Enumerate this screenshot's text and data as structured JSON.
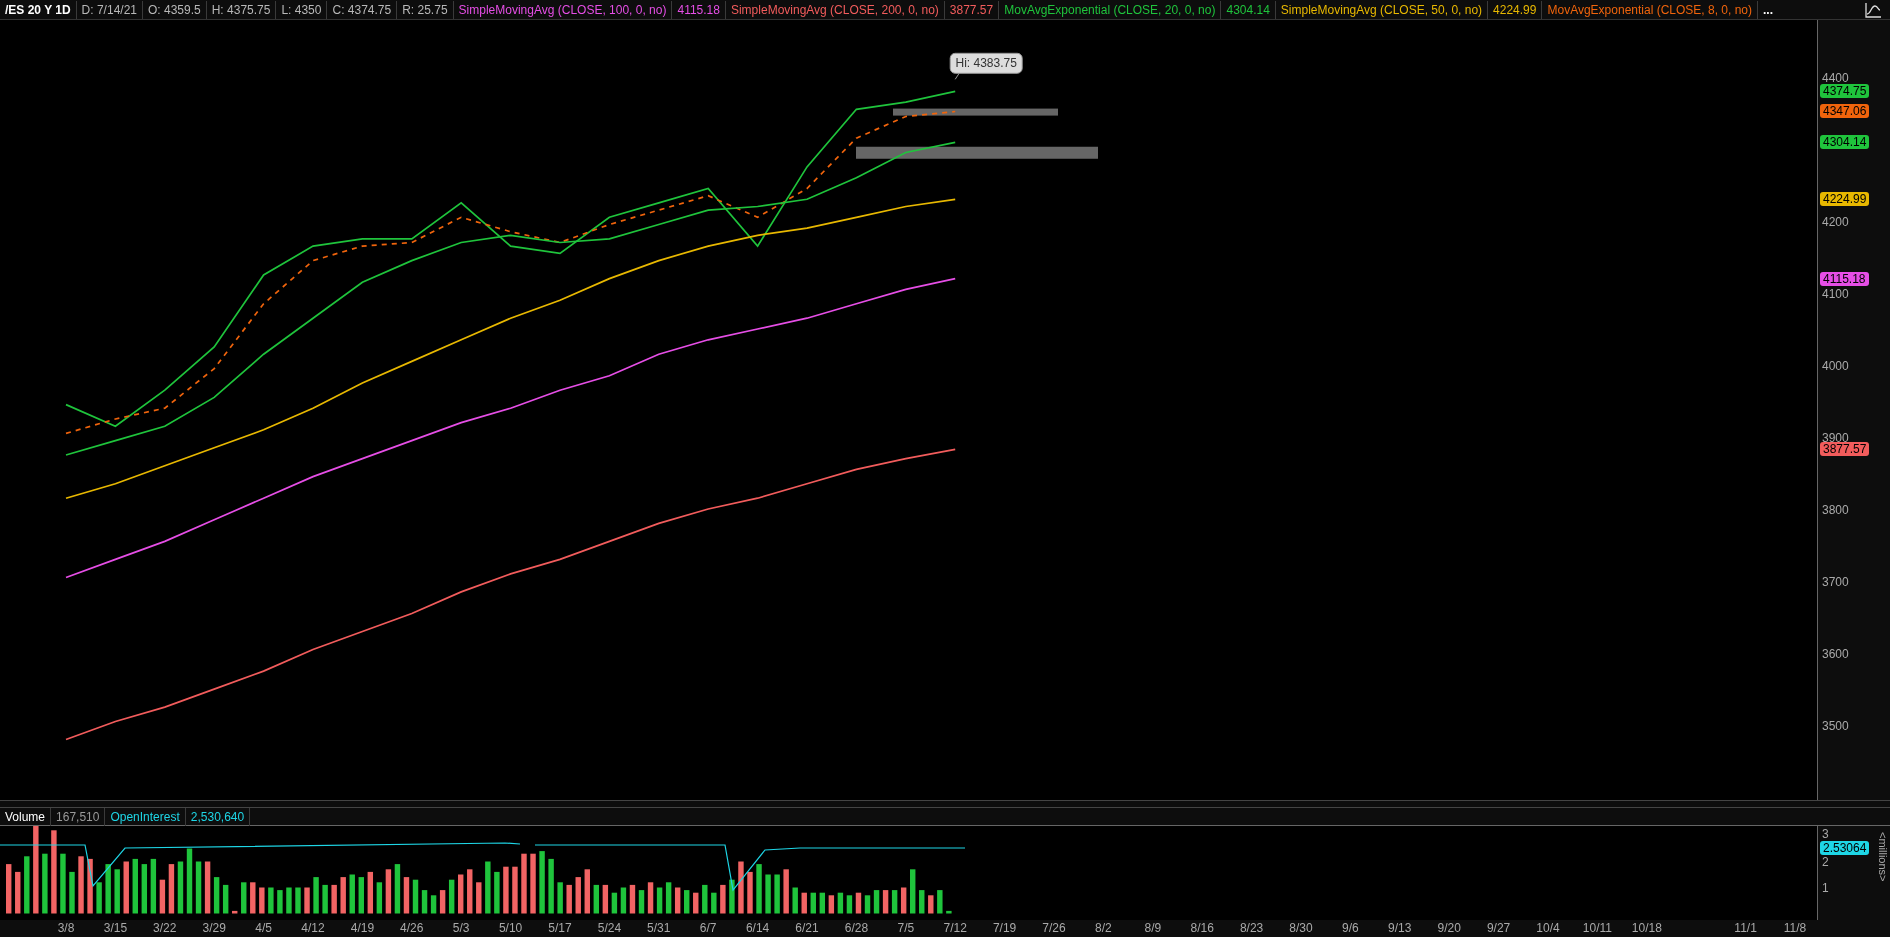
{
  "header": {
    "items": [
      {
        "kind": "symbol",
        "text": "/ES 20 Y 1D",
        "color": "#ffffff"
      },
      {
        "kind": "field",
        "text": "D: 7/14/21",
        "color": "#b8b8b8"
      },
      {
        "kind": "field",
        "text": "O: 4359.5",
        "color": "#b8b8b8"
      },
      {
        "kind": "field",
        "text": "H: 4375.75",
        "color": "#b8b8b8"
      },
      {
        "kind": "field",
        "text": "L: 4350",
        "color": "#b8b8b8"
      },
      {
        "kind": "field",
        "text": "C: 4374.75",
        "color": "#b8b8b8"
      },
      {
        "kind": "field",
        "text": "R: 25.75",
        "color": "#b8b8b8"
      },
      {
        "kind": "study",
        "text": "SimpleMovingAvg (CLOSE, 100, 0, no)",
        "color": "#e64ee6"
      },
      {
        "kind": "field",
        "text": "4115.18",
        "color": "#e64ee6"
      },
      {
        "kind": "study",
        "text": "SimpleMovingAvg (CLOSE, 200, 0, no)",
        "color": "#f25c5c"
      },
      {
        "kind": "field",
        "text": "3877.57",
        "color": "#f25c5c"
      },
      {
        "kind": "study",
        "text": "MovAvgExponential (CLOSE, 20, 0, no)",
        "color": "#1fc43c"
      },
      {
        "kind": "field",
        "text": "4304.14",
        "color": "#1fc43c"
      },
      {
        "kind": "study",
        "text": "SimpleMovingAvg (CLOSE, 50, 0, no)",
        "color": "#e8b800"
      },
      {
        "kind": "field",
        "text": "4224.99",
        "color": "#e8b800"
      },
      {
        "kind": "study",
        "text": "MovAvgExponential (CLOSE, 8, 0, no)",
        "color": "#f0640c"
      },
      {
        "kind": "more",
        "text": "...",
        "color": "#ffffff"
      }
    ]
  },
  "price_chart": {
    "badges": [
      "4374.75",
      "4347.06",
      "4304.14",
      "4224.99",
      "4115.18",
      "3877.57"
    ],
    "chart_data": {
      "type": "line",
      "categories": [
        "3/8",
        "3/15",
        "3/22",
        "3/29",
        "4/5",
        "4/12",
        "4/19",
        "4/26",
        "5/3",
        "5/10",
        "5/17",
        "5/24",
        "5/31",
        "6/7",
        "6/14",
        "6/21",
        "6/28",
        "7/5",
        "7/12",
        "7/19",
        "7/26",
        "8/2",
        "8/9",
        "8/16",
        "8/23",
        "8/30",
        "9/6",
        "9/13",
        "9/20",
        "9/27",
        "10/4",
        "10/11",
        "10/18",
        null,
        "11/1",
        "11/8"
      ],
      "ylim": [
        3391,
        4474
      ],
      "yticks": [
        3500,
        3600,
        3700,
        3800,
        3900,
        4000,
        4100,
        4200,
        4400
      ],
      "series": [
        {
          "color": "#1fc43c",
          "line_style": "solid",
          "values": [
            3940,
            3910,
            3960,
            4020,
            4120,
            4160,
            4170,
            4170,
            4220,
            4160,
            4150,
            4200,
            4220,
            4240,
            4160,
            4270,
            4350,
            4360,
            4375,
            null,
            null,
            null,
            null,
            null,
            null,
            null,
            null,
            null,
            null,
            null,
            null,
            null,
            null,
            null,
            null,
            null
          ]
        },
        {
          "color": "#f0640c",
          "line_style": "dashed",
          "values": [
            3900,
            3920,
            3935,
            3990,
            4080,
            4140,
            4160,
            4165,
            4200,
            4180,
            4165,
            4190,
            4210,
            4230,
            4200,
            4240,
            4310,
            4340,
            4347,
            null,
            null,
            null,
            null,
            null,
            null,
            null,
            null,
            null,
            null,
            null,
            null,
            null,
            null,
            null,
            null,
            null
          ]
        },
        {
          "color": "#1fc43c",
          "line_style": "solid",
          "values": [
            3870,
            3890,
            3910,
            3950,
            4010,
            4060,
            4110,
            4140,
            4165,
            4175,
            4165,
            4170,
            4190,
            4210,
            4215,
            4225,
            4255,
            4290,
            4304,
            null,
            null,
            null,
            null,
            null,
            null,
            null,
            null,
            null,
            null,
            null,
            null,
            null,
            null,
            null,
            null,
            null
          ]
        },
        {
          "color": "#e8b800",
          "line_style": "solid",
          "values": [
            3810,
            3830,
            3855,
            3880,
            3905,
            3935,
            3970,
            4000,
            4030,
            4060,
            4085,
            4115,
            4140,
            4160,
            4175,
            4185,
            4200,
            4215,
            4225,
            null,
            null,
            null,
            null,
            null,
            null,
            null,
            null,
            null,
            null,
            null,
            null,
            null,
            null,
            null,
            null,
            null
          ]
        },
        {
          "color": "#e64ee6",
          "line_style": "solid",
          "values": [
            3700,
            3725,
            3750,
            3780,
            3810,
            3840,
            3865,
            3890,
            3915,
            3935,
            3960,
            3980,
            4010,
            4030,
            4045,
            4060,
            4080,
            4100,
            4115,
            null,
            null,
            null,
            null,
            null,
            null,
            null,
            null,
            null,
            null,
            null,
            null,
            null,
            null,
            null,
            null,
            null
          ]
        },
        {
          "color": "#f25c5c",
          "line_style": "solid",
          "values": [
            3475,
            3500,
            3520,
            3545,
            3570,
            3600,
            3625,
            3650,
            3680,
            3705,
            3725,
            3750,
            3775,
            3795,
            3810,
            3830,
            3850,
            3865,
            3878,
            null,
            null,
            null,
            null,
            null,
            null,
            null,
            null,
            null,
            null,
            null,
            null,
            null,
            null,
            null,
            null,
            null
          ]
        }
      ],
      "annotations": [
        "Hi: 4383.75"
      ]
    }
  },
  "volume_panel": {
    "legend": [
      {
        "text": "Volume",
        "color": "#ffffff"
      },
      {
        "text": "167,510",
        "color": "#9a9a9a"
      },
      {
        "text": "OpenInterest",
        "color": "#1ed6e6"
      },
      {
        "text": "2,530,640",
        "color": "#1ed6e6"
      }
    ],
    "badge": "2.53064",
    "unit": "<millions>",
    "scale_labels": [
      "3",
      "2",
      "1"
    ]
  }
}
